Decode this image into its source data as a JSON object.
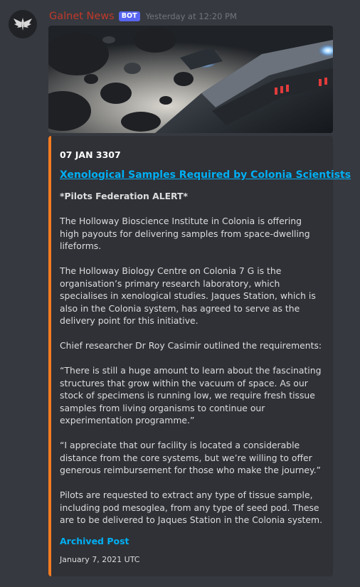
{
  "message": {
    "author": "Galnet News",
    "badge": "BOT",
    "timestamp": "Yesterday at 12:20 PM",
    "avatar_icon": "elite-dangerous-wings-icon"
  },
  "embed": {
    "accent_color": "#f47b20",
    "author": "07 JAN 3307",
    "title": "Xenological Samples Required by Colonia Scientists",
    "paragraphs": [
      "*Pilots Federation ALERT*",
      "The Holloway Bioscience Institute in Colonia is offering high payouts for delivering samples from space-dwelling lifeforms.",
      "The Holloway Biology Centre on Colonia 7 G is the organisation’s primary research laboratory, which specialises in xenological studies. Jaques Station, which is also in the Colonia system, has agreed to serve as the delivery point for this initiative.",
      "Chief researcher Dr Roy Casimir outlined the requirements:",
      "“There is still a huge amount to learn about the fascinating structures that grow within the vacuum of space. As our stock of specimens is running low, we require fresh tissue samples from living organisms to continue our experimentation programme.”",
      "“I appreciate that our facility is located a considerable distance from the core systems, but we’re willing to offer generous reimbursement for those who make the journey.”",
      "Pilots are requested to extract any type of tissue sample, including pod mesoglea, from any type of seed pod. These are to be delivered to Jaques Station in the Colonia system."
    ],
    "field_name": "Archived Post",
    "footer": "January 7, 2021 UTC"
  }
}
